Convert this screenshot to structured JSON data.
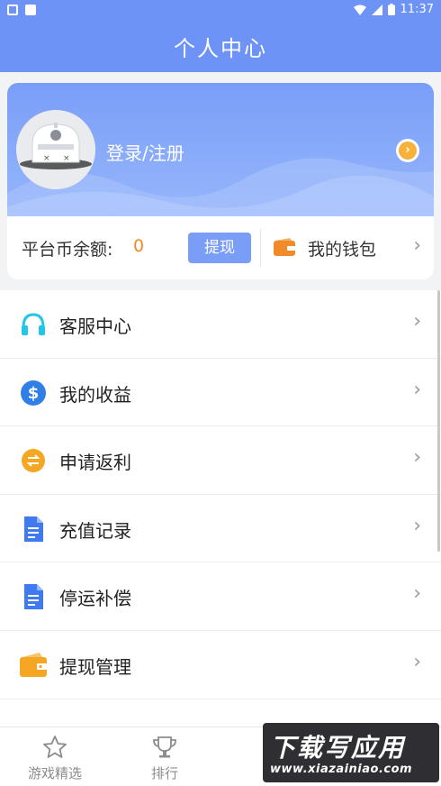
{
  "status_bar": {
    "time": "11:37"
  },
  "header": {
    "title": "个人中心"
  },
  "profile": {
    "login_label": "登录/注册"
  },
  "balance": {
    "label": "平台币余额:",
    "value": "0",
    "withdraw_label": "提现",
    "wallet_label": "我的钱包"
  },
  "menu": {
    "items": [
      {
        "label": "客服中心",
        "icon": "headset-icon"
      },
      {
        "label": "我的收益",
        "icon": "dollar-icon"
      },
      {
        "label": "申请返利",
        "icon": "exchange-icon"
      },
      {
        "label": "充值记录",
        "icon": "document-icon"
      },
      {
        "label": "停运补偿",
        "icon": "document-icon"
      },
      {
        "label": "提现管理",
        "icon": "wallet-icon"
      }
    ]
  },
  "bottom_nav": {
    "items": [
      {
        "label": "游戏精选",
        "icon": "star-icon"
      },
      {
        "label": "排行",
        "icon": "trophy-icon"
      }
    ]
  },
  "watermark": {
    "title": "下载写应用",
    "url": "www.xiazainiao.com"
  },
  "colors": {
    "primary": "#6e93f6",
    "accent": "#f08a2a",
    "cyan": "#22c6e8",
    "blue": "#2f7fe6",
    "orange": "#f5a623",
    "doc_blue": "#3f7af0"
  }
}
